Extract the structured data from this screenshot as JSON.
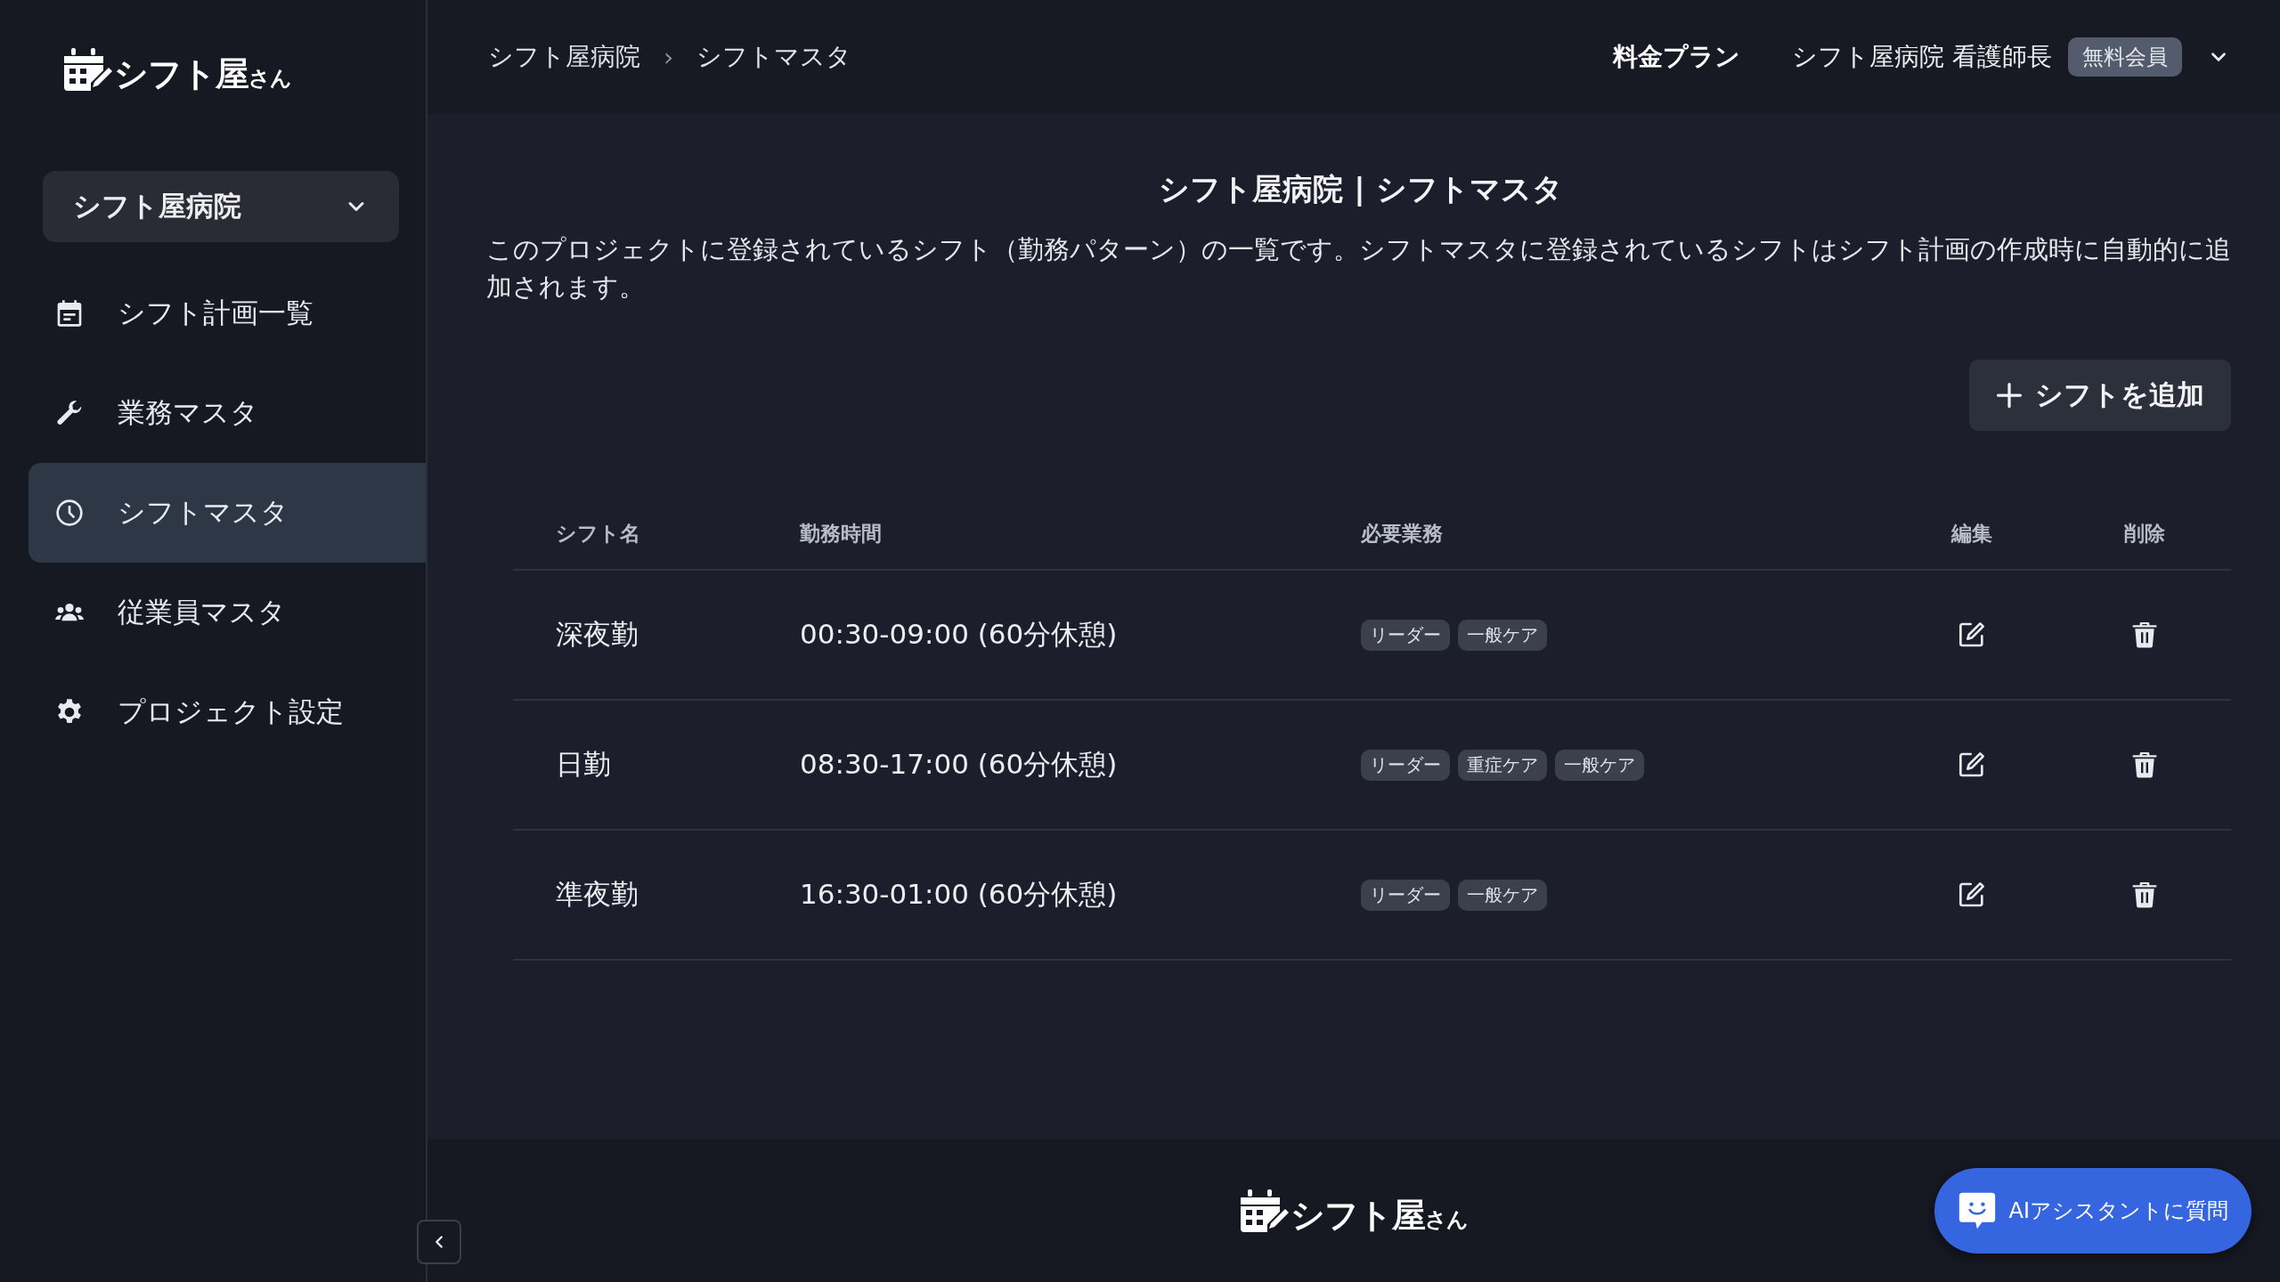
{
  "logo": {
    "name": "シフト屋",
    "suffix": "さん"
  },
  "sidebar": {
    "project": "シフト屋病院",
    "items": [
      {
        "label": "シフト計画一覧",
        "kind": "calendar",
        "selected": false
      },
      {
        "label": "業務マスタ",
        "kind": "wrench",
        "selected": false
      },
      {
        "label": "シフトマスタ",
        "kind": "clock",
        "selected": true
      },
      {
        "label": "従業員マスタ",
        "kind": "users",
        "selected": false
      },
      {
        "label": "プロジェクト設定",
        "kind": "gear",
        "selected": false
      }
    ]
  },
  "header": {
    "breadcrumb": [
      "シフト屋病院",
      "シフトマスタ"
    ],
    "separator": "›",
    "plan_link": "料金プラン",
    "user": "シフト屋病院 看護師長",
    "badge": "無料会員"
  },
  "page": {
    "title": "シフト屋病院 | シフトマスタ",
    "description": "このプロジェクトに登録されているシフト（勤務パターン）の一覧です。シフトマスタに登録されているシフトはシフト計画の作成時に自動的に追加されます。",
    "add_button": "シフトを追加"
  },
  "table": {
    "columns": [
      "シフト名",
      "勤務時間",
      "必要業務",
      "編集",
      "削除"
    ],
    "rows": [
      {
        "name": "深夜勤",
        "time": "00:30-09:00 (60分休憩)",
        "tasks": [
          "リーダー",
          "一般ケア"
        ]
      },
      {
        "name": "日勤",
        "time": "08:30-17:00 (60分休憩)",
        "tasks": [
          "リーダー",
          "重症ケア",
          "一般ケア"
        ]
      },
      {
        "name": "準夜勤",
        "time": "16:30-01:00 (60分休憩)",
        "tasks": [
          "リーダー",
          "一般ケア"
        ]
      }
    ]
  },
  "footer": {
    "logo": {
      "name": "シフト屋",
      "suffix": "さん"
    }
  },
  "assistant_button": "AIアシスタントに質問"
}
